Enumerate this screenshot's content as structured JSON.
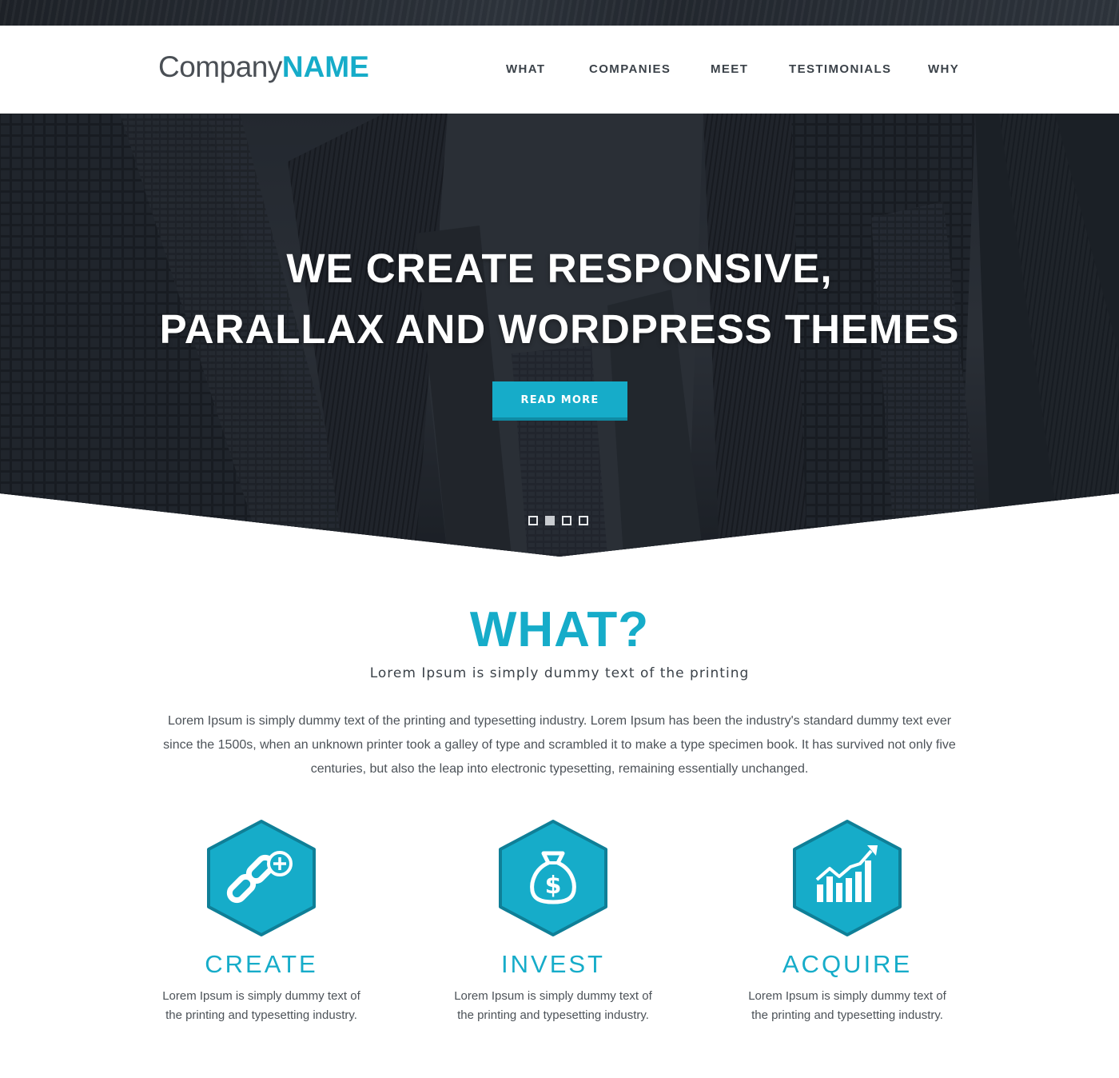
{
  "brand": {
    "name_light": "Company",
    "name_bold": "NAME"
  },
  "nav": {
    "items": [
      {
        "label": "WHAT",
        "active": true
      },
      {
        "label": "COMPANIES",
        "active": false
      },
      {
        "label": "MEET",
        "active": false
      },
      {
        "label": "TESTIMONIALS",
        "active": false
      },
      {
        "label": "WHY",
        "active": false
      }
    ]
  },
  "hero": {
    "title_line1": "WE CREATE RESPONSIVE,",
    "title_line2": "PARALLAX AND WORDPRESS THEMES",
    "button_label": "READ MORE",
    "slides_total": 4,
    "active_slide": 2
  },
  "what": {
    "heading": "WHAT?",
    "subheading": "Lorem Ipsum is simply dummy text of the printing",
    "body": "Lorem Ipsum is simply dummy text of the printing and typesetting industry. Lorem Ipsum has been the industry's standard dummy text ever since the 1500s, when an unknown printer took a galley of type and scrambled it to make a type specimen book. It has survived not only five centuries, but also the leap into electronic typesetting, remaining essentially unchanged.",
    "features": [
      {
        "icon": "chain-link-plus-icon",
        "title": "CREATE",
        "text": "Lorem Ipsum is simply dummy text of the printing and typesetting industry."
      },
      {
        "icon": "money-bag-icon",
        "title": "INVEST",
        "text": "Lorem Ipsum is simply dummy text of the printing and typesetting industry."
      },
      {
        "icon": "growth-chart-icon",
        "title": "ACQUIRE",
        "text": "Lorem Ipsum is simply dummy text of the printing and typesetting industry."
      }
    ]
  },
  "colors": {
    "accent": "#16acc9",
    "accent_dark": "#0f7f97",
    "text_dark": "#3b4249",
    "hero_bg": "#20252c"
  }
}
